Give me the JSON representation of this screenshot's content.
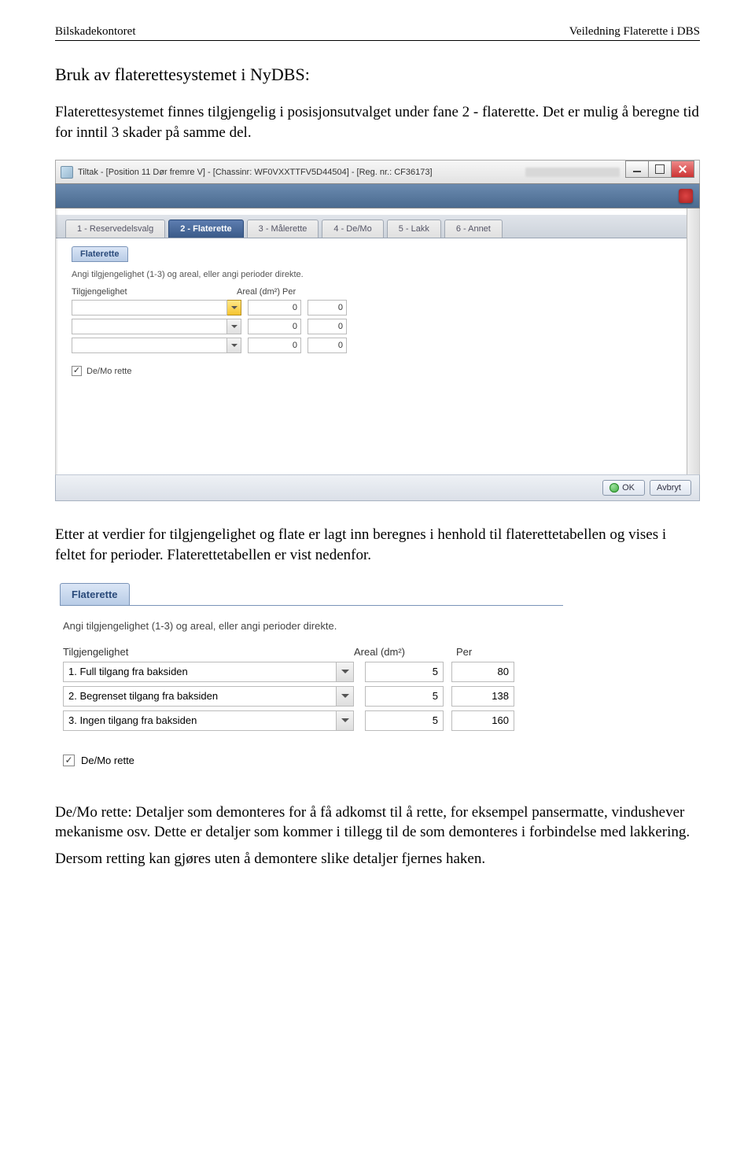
{
  "header": {
    "left": "Bilskadekontoret",
    "right": "Veiledning Flaterette i DBS"
  },
  "title": "Bruk av flaterettesystemet i NyDBS:",
  "para1": "Flaterettesystemet finnes tilgjengelig i posisjonsutvalget under fane 2 - flaterette. Det er mulig å beregne tid for inntil 3 skader på samme del.",
  "app": {
    "window_title": "Tiltak - [Position 11 Dør fremre V] - [Chassinr: WF0VXXTTFV5D44504] - [Reg. nr.: CF36173]",
    "tabs": [
      "1 - Reservedelsvalg",
      "2 - Flaterette",
      "3 - Målerette",
      "4 - De/Mo",
      "5 - Lakk",
      "6 - Annet"
    ],
    "active_tab": 1,
    "panel_title": "Flaterette",
    "panel_instr": "Angi tilgjengelighet (1-3) og areal, eller angi perioder direkte.",
    "col_tilg": "Tilgjengelighet",
    "col_areal": "Areal (dm²) Per",
    "rows": [
      {
        "tilg": "",
        "areal": "0",
        "per": "0",
        "hl": true
      },
      {
        "tilg": "",
        "areal": "0",
        "per": "0",
        "hl": false
      },
      {
        "tilg": "",
        "areal": "0",
        "per": "0",
        "hl": false
      }
    ],
    "chk_label": "De/Mo rette",
    "chk_checked": true,
    "ok": "OK",
    "cancel": "Avbryt"
  },
  "para2": "Etter at verdier for tilgjengelighet og flate er lagt inn beregnes i henhold til flaterettetabellen og vises i feltet for perioder. Flaterettetabellen er vist nedenfor.",
  "zoom": {
    "panel_title": "Flaterette",
    "panel_instr": "Angi tilgjengelighet (1-3) og areal, eller angi perioder direkte.",
    "col_tilg": "Tilgjengelighet",
    "col_areal": "Areal (dm²)",
    "col_per": "Per",
    "rows": [
      {
        "tilg": "1. Full tilgang fra baksiden",
        "areal": "5",
        "per": "80"
      },
      {
        "tilg": "2. Begrenset tilgang fra baksiden",
        "areal": "5",
        "per": "138"
      },
      {
        "tilg": "3. Ingen tilgang fra baksiden",
        "areal": "5",
        "per": "160"
      }
    ],
    "chk_label": "De/Mo rette",
    "chk_checked": true
  },
  "para3": "De/Mo rette:  Detaljer som demonteres for å få adkomst til å rette, for eksempel pansermatte, vindushever mekanisme osv. Dette er detaljer som kommer i tillegg til de som demonteres i forbindelse med lakkering.",
  "para4": "Dersom retting kan gjøres uten å demontere slike detaljer fjernes haken."
}
